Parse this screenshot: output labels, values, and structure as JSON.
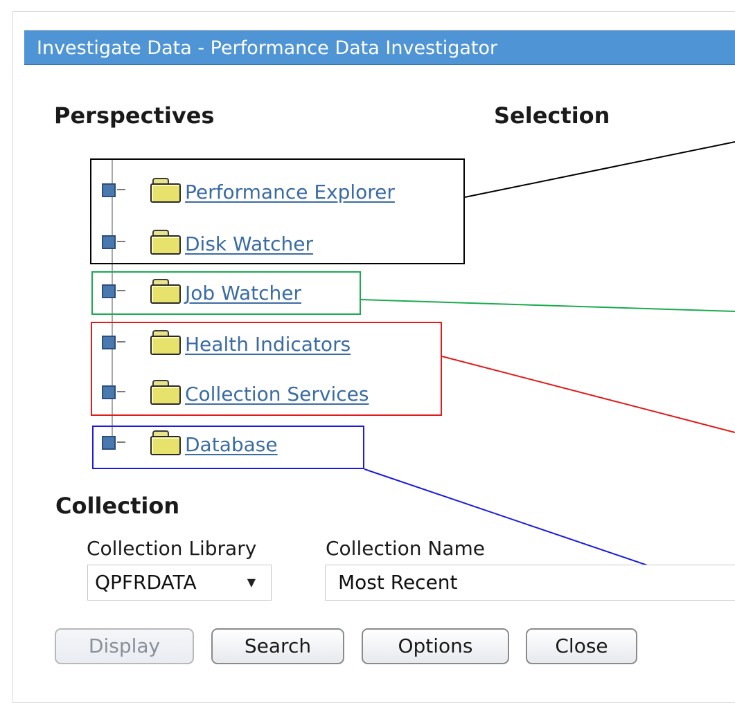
{
  "window": {
    "title": "Investigate Data - Performance Data Investigator"
  },
  "perspectives": {
    "heading": "Perspectives",
    "items": [
      {
        "label": "Performance Explorer"
      },
      {
        "label": "Disk Watcher"
      },
      {
        "label": "Job Watcher"
      },
      {
        "label": "Health Indicators"
      },
      {
        "label": "Collection Services"
      },
      {
        "label": "Database"
      }
    ]
  },
  "selection": {
    "heading": "Selection"
  },
  "collection": {
    "heading": "Collection",
    "library_label": "Collection Library",
    "library_value": "QPFRDATA",
    "name_label": "Collection Name",
    "name_value": "Most Recent"
  },
  "buttons": {
    "display": "Display",
    "search": "Search",
    "options": "Options",
    "close": "Close"
  },
  "colors": {
    "titlebar": "#4f94d4",
    "link": "#3a6ba3",
    "callout_black": "#000000",
    "callout_green": "#1aaa4e",
    "callout_red": "#e01b1b",
    "callout_blue": "#1a1ae0"
  },
  "icons": {
    "tree_node": "expand-node-icon",
    "folder": "folder-icon",
    "dropdown": "chevron-down-icon"
  }
}
